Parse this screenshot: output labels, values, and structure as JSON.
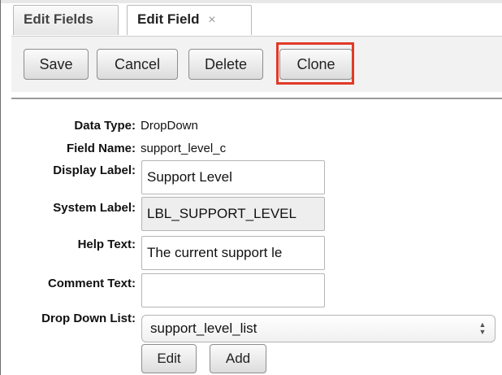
{
  "tabs": [
    {
      "label": "Edit Fields"
    },
    {
      "label": "Edit Field",
      "close_symbol": "×"
    }
  ],
  "toolbar": {
    "save_label": "Save",
    "cancel_label": "Cancel",
    "delete_label": "Delete",
    "clone_label": "Clone"
  },
  "highlight_color": "#e03a28",
  "fields": {
    "data_type_label": "Data Type:",
    "data_type_value": "DropDown",
    "field_name_label": "Field Name:",
    "field_name_value": "support_level_c",
    "display_label_label": "Display Label:",
    "display_label_value": "Support Level",
    "system_label_label": "System Label:",
    "system_label_value": "LBL_SUPPORT_LEVEL",
    "help_text_label": "Help Text:",
    "help_text_value": "The current support le",
    "comment_text_label": "Comment Text:",
    "comment_text_value": "",
    "drop_down_list_label": "Drop Down List:",
    "drop_down_list_value": "support_level_list"
  },
  "list_buttons": {
    "edit_label": "Edit",
    "add_label": "Add"
  }
}
